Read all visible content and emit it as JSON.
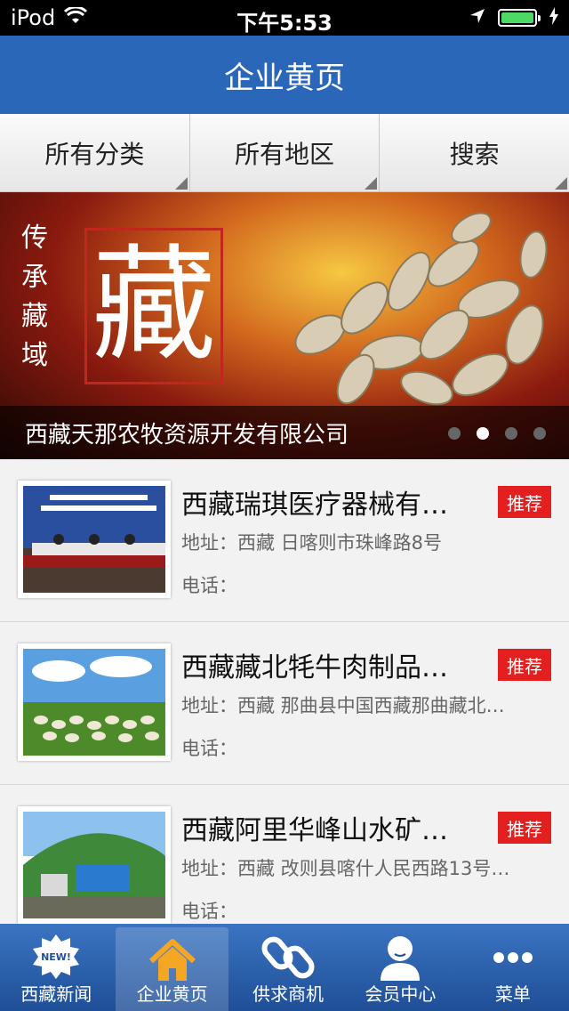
{
  "status_bar": {
    "carrier": "iPod",
    "time": "下午5:53"
  },
  "header": {
    "title": "企业黄页"
  },
  "filters": [
    {
      "label": "所有分类"
    },
    {
      "label": "所有地区"
    },
    {
      "label": "搜索"
    }
  ],
  "banner": {
    "calligraphy": "传承藏域",
    "big_char": "藏",
    "caption": "西藏天那农牧资源开发有限公司",
    "slides": 4,
    "active_slide": 2
  },
  "listings": [
    {
      "title": "西藏瑞琪医疗器械有…",
      "badge": "推荐",
      "address": "地址：西藏 日喀则市珠峰路8号",
      "phone": "电话："
    },
    {
      "title": "西藏藏北牦牛肉制品…",
      "badge": "推荐",
      "address": "地址：西藏 那曲县中国西藏那曲藏北…",
      "phone": "电话："
    },
    {
      "title": "西藏阿里华峰山水矿…",
      "badge": "推荐",
      "address": "地址：西藏 改则县喀什人民西路13号…",
      "phone": "电话："
    }
  ],
  "tabs": [
    {
      "label": "西藏新闻",
      "icon": "new-badge-icon"
    },
    {
      "label": "企业黄页",
      "icon": "home-icon"
    },
    {
      "label": "供求商机",
      "icon": "chain-link-icon"
    },
    {
      "label": "会员中心",
      "icon": "user-icon"
    },
    {
      "label": "菜单",
      "icon": "more-dots-icon"
    }
  ],
  "tab_new_badge_text": "NEW!",
  "colors": {
    "nav": "#2b67b8",
    "badge": "#e41f1f",
    "tabbar": "#2b5ea8",
    "battery": "#4cd964"
  }
}
